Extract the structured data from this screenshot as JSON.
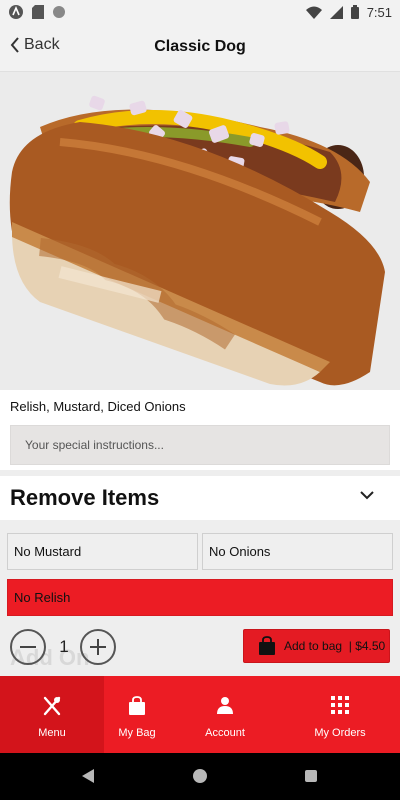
{
  "status_bar": {
    "time": "7:51",
    "icons": [
      "app-icon",
      "sd-card-icon",
      "circle-icon",
      "wifi-icon",
      "signal-icon",
      "battery-icon"
    ]
  },
  "header": {
    "back_label": "Back",
    "title": "Classic Dog"
  },
  "product": {
    "image": "hot-dog-image",
    "description": "Relish, Mustard, Diced Onions",
    "instructions_placeholder": "Your special instructions..."
  },
  "remove_items": {
    "title": "Remove Items",
    "options": [
      {
        "label": "No Mustard",
        "selected": false
      },
      {
        "label": "No Onions",
        "selected": false
      },
      {
        "label": "No Relish",
        "selected": true
      }
    ]
  },
  "add_on_ghost": "Add On",
  "quantity": {
    "value": "1"
  },
  "add_to_bag": {
    "label": "Add to bag",
    "price": "$4.50"
  },
  "tab_bar": {
    "tabs": [
      {
        "label": "Menu",
        "icon": "utensils-icon",
        "active": true
      },
      {
        "label": "My Bag",
        "icon": "bag-icon",
        "active": false
      },
      {
        "label": "Account",
        "icon": "person-icon",
        "active": false
      },
      {
        "label": "My Orders",
        "icon": "grid-icon",
        "active": false
      }
    ]
  },
  "colors": {
    "brand_red": "#ec1c24",
    "active_tab": "#d3141b",
    "background_gray": "#eeeeee"
  }
}
